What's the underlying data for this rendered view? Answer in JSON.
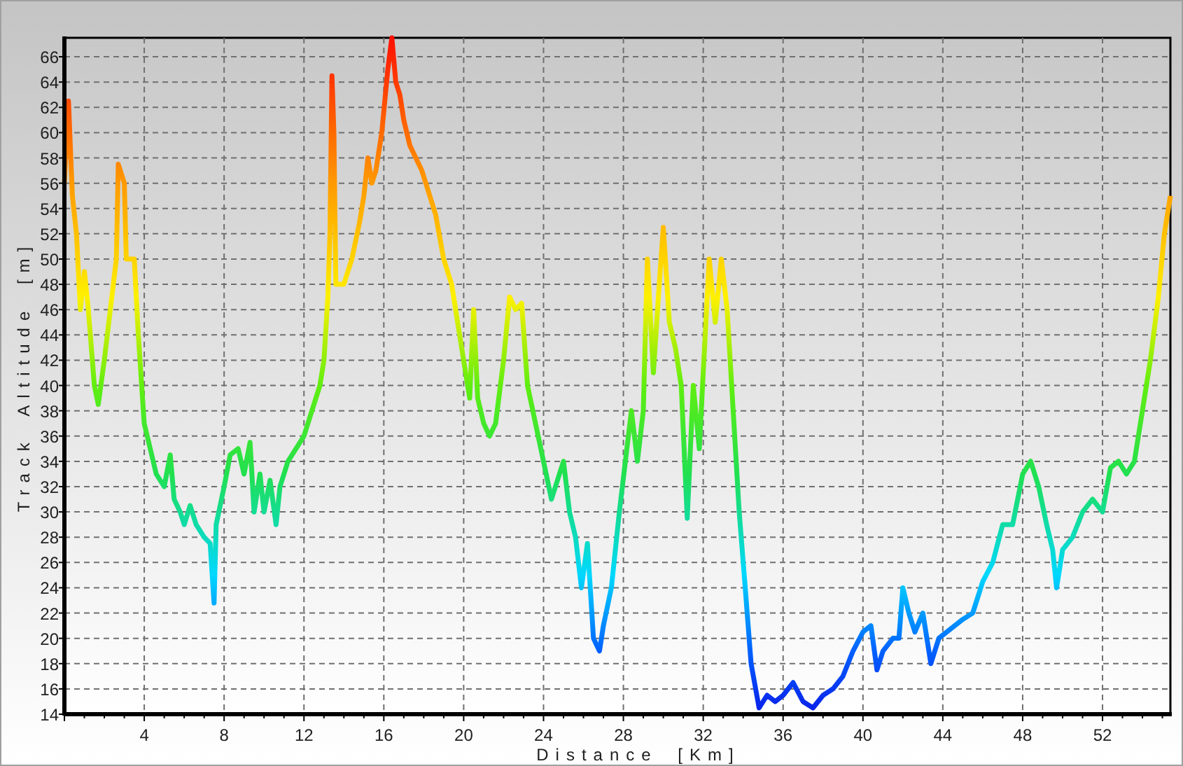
{
  "chart": {
    "chart_data": {
      "type": "line",
      "xlabel": "Distance [Km]",
      "ylabel": "Track Altitude [m]",
      "x": [
        0,
        0.2,
        0.4,
        0.6,
        0.8,
        1.0,
        1.2,
        1.5,
        1.7,
        2.0,
        2.3,
        2.6,
        2.7,
        3.0,
        3.1,
        3.5,
        3.7,
        4.0,
        4.3,
        4.6,
        5.0,
        5.3,
        5.5,
        5.8,
        6.0,
        6.3,
        6.6,
        7.0,
        7.3,
        7.5,
        7.6,
        8.0,
        8.3,
        8.7,
        9.0,
        9.3,
        9.5,
        9.8,
        10.0,
        10.3,
        10.6,
        10.8,
        11.2,
        11.6,
        12.0,
        12.4,
        12.8,
        13.0,
        13.2,
        13.3,
        13.4,
        13.5,
        13.6,
        14.0,
        14.4,
        14.8,
        15.0,
        15.2,
        15.4,
        15.6,
        15.9,
        16.2,
        16.4,
        16.6,
        16.8,
        17.0,
        17.3,
        17.6,
        17.9,
        18.3,
        18.6,
        19.0,
        19.4,
        19.8,
        20.1,
        20.3,
        20.5,
        20.7,
        21.0,
        21.3,
        21.6,
        22.0,
        22.3,
        22.6,
        22.9,
        23.2,
        23.6,
        24.0,
        24.4,
        24.8,
        25.0,
        25.3,
        25.6,
        25.9,
        26.2,
        26.5,
        26.8,
        27.0,
        27.4,
        27.8,
        28.1,
        28.4,
        28.7,
        29.0,
        29.2,
        29.5,
        29.8,
        30.0,
        30.3,
        30.6,
        30.9,
        31.2,
        31.5,
        31.8,
        32.0,
        32.3,
        32.6,
        32.9,
        33.2,
        33.5,
        33.8,
        34.1,
        34.4,
        34.8,
        35.2,
        35.6,
        36.0,
        36.5,
        37.0,
        37.5,
        38.0,
        38.5,
        39.0,
        39.5,
        40.0,
        40.4,
        40.7,
        41.0,
        41.5,
        41.8,
        42.0,
        42.3,
        42.6,
        43.0,
        43.4,
        43.8,
        44.2,
        44.6,
        45.0,
        45.5,
        46.0,
        46.5,
        47.0,
        47.5,
        48.0,
        48.4,
        48.8,
        49.2,
        49.5,
        49.7,
        50.0,
        50.5,
        51.0,
        51.5,
        52.0,
        52.4,
        52.8,
        53.2,
        53.6,
        54.0,
        54.4,
        54.8,
        55.1,
        55.4
      ],
      "series": [
        {
          "values": [
            56,
            62.5,
            55,
            52,
            46,
            49,
            46,
            40,
            38.5,
            42,
            46,
            50,
            57.5,
            56,
            50,
            50,
            44,
            37,
            35,
            33,
            32,
            34.5,
            31,
            30,
            29,
            30.5,
            29,
            28,
            27.5,
            22.8,
            29,
            32,
            34.5,
            35,
            33,
            35.5,
            30,
            33,
            30,
            32.5,
            29,
            32,
            34,
            35,
            36,
            38,
            40,
            42,
            47,
            52,
            64.5,
            60,
            48,
            48,
            50,
            53,
            55,
            58,
            56,
            57,
            60,
            65,
            67.5,
            64,
            63,
            61,
            59,
            58,
            57,
            55,
            53.5,
            50,
            48,
            44,
            41,
            39,
            46,
            39,
            37,
            36,
            37,
            42,
            47,
            46,
            46.5,
            40,
            37,
            34,
            31,
            33,
            34,
            30,
            28,
            24,
            27.5,
            20,
            19,
            21,
            24,
            30,
            34,
            38,
            34,
            38,
            50,
            41,
            48,
            52.5,
            45,
            43,
            40,
            29.5,
            40,
            35,
            41,
            50,
            45,
            50,
            46,
            38,
            30,
            24,
            18,
            14.5,
            15.5,
            15,
            15.5,
            16.5,
            15,
            14.5,
            15.5,
            16,
            17,
            19,
            20.5,
            21,
            17.5,
            19,
            20,
            20,
            24,
            22,
            20.5,
            22,
            18,
            20,
            20.5,
            21,
            21.5,
            22,
            24.5,
            26,
            29,
            29,
            33,
            34,
            32,
            29,
            27,
            24,
            27,
            28,
            30,
            31,
            30,
            33.5,
            34,
            33,
            34,
            38,
            42,
            47,
            52,
            55
          ]
        }
      ],
      "xlim": [
        0,
        55.4
      ],
      "ylim": [
        14,
        67.5
      ],
      "grid": true,
      "xticks": [
        4,
        8,
        12,
        16,
        20,
        24,
        28,
        32,
        36,
        40,
        44,
        48,
        52
      ],
      "yticks": [
        14,
        16,
        18,
        20,
        22,
        24,
        26,
        28,
        30,
        32,
        34,
        36,
        38,
        40,
        42,
        44,
        46,
        48,
        50,
        52,
        54,
        56,
        58,
        60,
        62,
        64,
        66
      ]
    }
  }
}
